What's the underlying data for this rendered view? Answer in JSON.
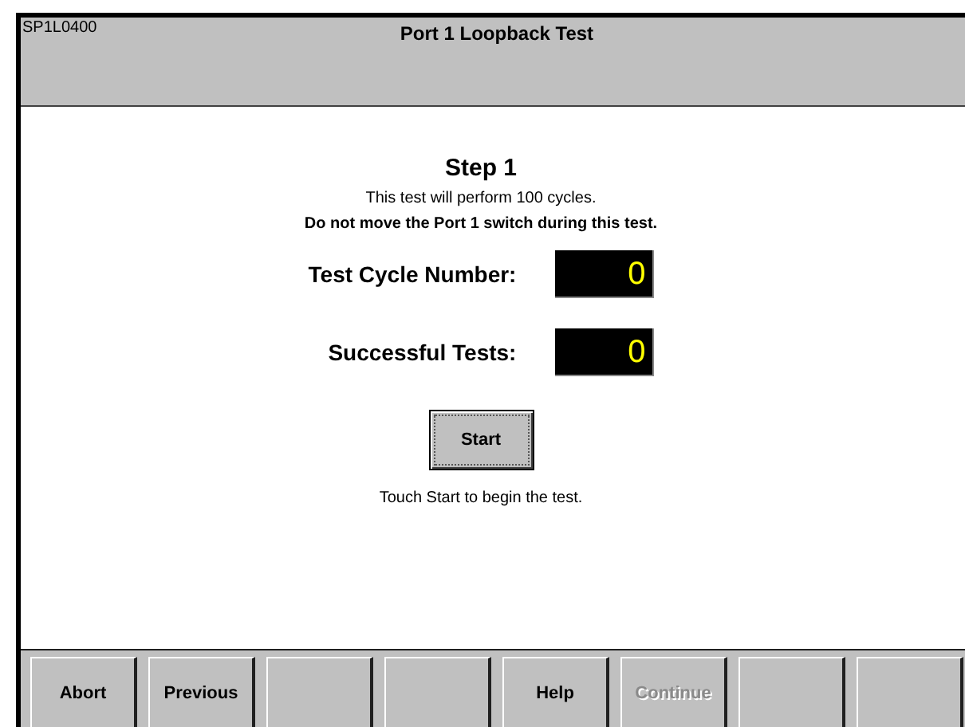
{
  "header": {
    "screen_id": "SP1L0400",
    "title": "Port 1 Loopback Test"
  },
  "content": {
    "step": "Step 1",
    "info": "This test will perform 100 cycles.",
    "warning": "Do not move the Port 1 switch during this test.",
    "counters": [
      {
        "label": "Test Cycle Number:",
        "value": "0"
      },
      {
        "label": "Successful Tests:",
        "value": "0"
      }
    ],
    "start_button": "Start",
    "hint": "Touch Start to begin the test."
  },
  "function_keys": [
    {
      "kind": "labeled",
      "label": "Abort",
      "disabled": false
    },
    {
      "kind": "labeled",
      "label": "Previous",
      "disabled": false
    },
    {
      "kind": "blank"
    },
    {
      "kind": "blank"
    },
    {
      "kind": "labeled",
      "label": "Help",
      "disabled": false
    },
    {
      "kind": "labeled",
      "label": "Continue",
      "disabled": true
    },
    {
      "kind": "blank"
    },
    {
      "kind": "blank"
    }
  ]
}
